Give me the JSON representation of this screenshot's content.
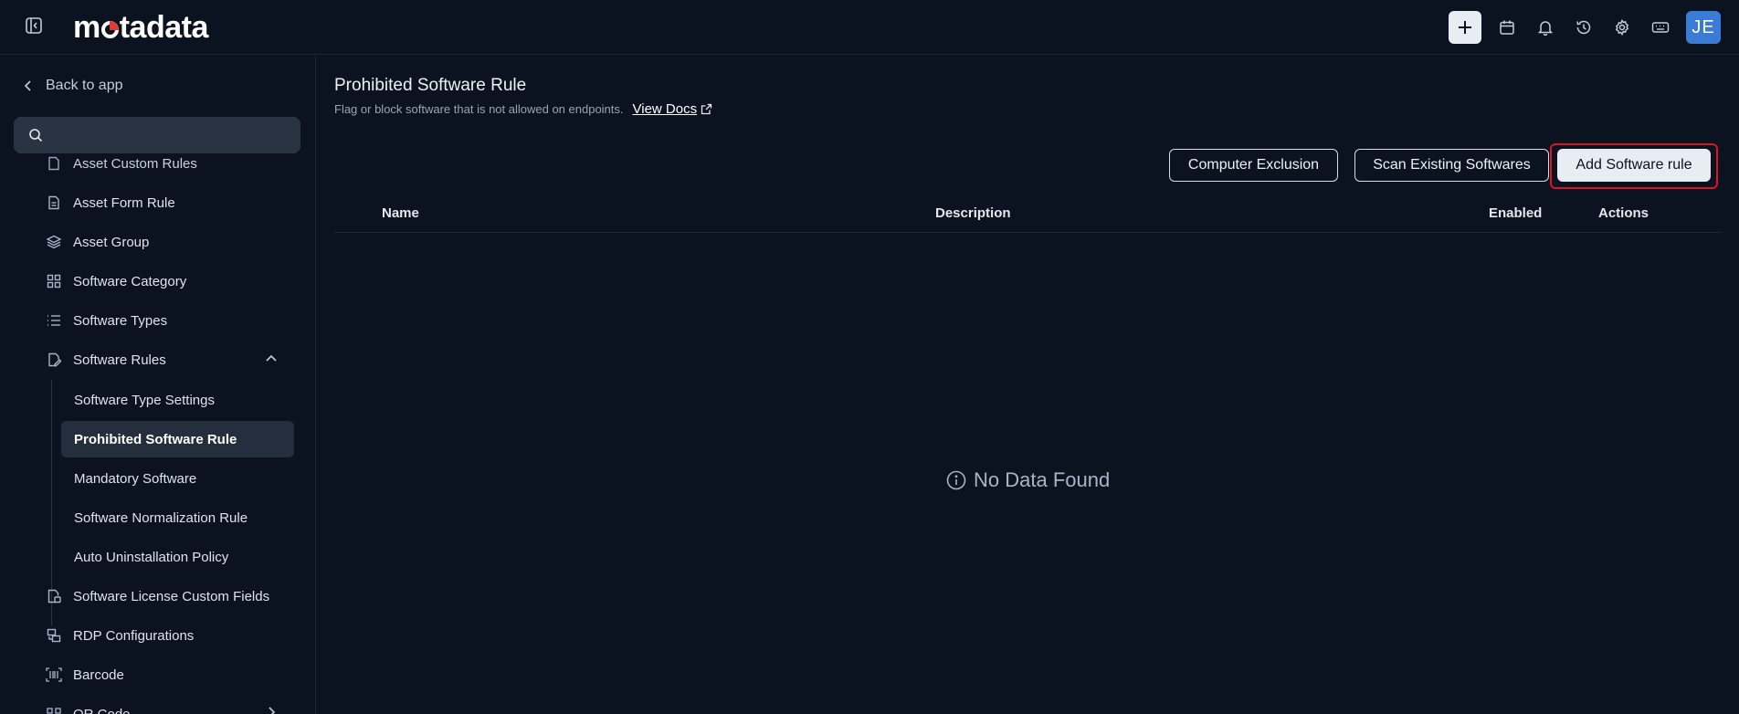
{
  "brand": {
    "logo_text_pre": "m",
    "logo_text_post": "tadata",
    "accent": "#e53935"
  },
  "topbar": {
    "icons": [
      "plus-icon",
      "calendar-icon",
      "bell-icon",
      "history-icon",
      "gear-icon",
      "keyboard-icon"
    ],
    "avatar_initials": "JE",
    "avatar_color": "#3a7bd5"
  },
  "sidebar": {
    "back_label": "Back to app",
    "search_placeholder": "",
    "partial_top": "Asset Custom Rules",
    "items": [
      {
        "label": "Asset Form Rule",
        "icon": "file-icon"
      },
      {
        "label": "Asset Group",
        "icon": "layers-icon"
      },
      {
        "label": "Software Category",
        "icon": "grid-icon"
      },
      {
        "label": "Software Types",
        "icon": "list-icon"
      },
      {
        "label": "Software Rules",
        "icon": "file-edit-icon"
      }
    ],
    "sub_items": [
      {
        "label": "Software Type Settings"
      },
      {
        "label": "Prohibited Software Rule",
        "active": true
      },
      {
        "label": "Mandatory Software"
      },
      {
        "label": "Software Normalization Rule"
      },
      {
        "label": "Auto Uninstallation Policy"
      }
    ],
    "items_after": [
      {
        "label": "Software License Custom Fields",
        "icon": "license-icon"
      },
      {
        "label": "RDP Configurations",
        "icon": "rdp-icon"
      },
      {
        "label": "Barcode",
        "icon": "barcode-icon"
      },
      {
        "label": "QR Code",
        "icon": "qrcode-icon"
      }
    ]
  },
  "main": {
    "title": "Prohibited Software Rule",
    "subtitle": "Flag or block software that is not allowed on endpoints.",
    "docs_label": "View Docs",
    "buttons": {
      "computer_exclusion": "Computer Exclusion",
      "scan_existing": "Scan Existing Softwares",
      "add_rule": "Add Software rule"
    },
    "columns": [
      "Name",
      "Description",
      "Enabled",
      "Actions"
    ],
    "empty_text": "No Data Found"
  }
}
